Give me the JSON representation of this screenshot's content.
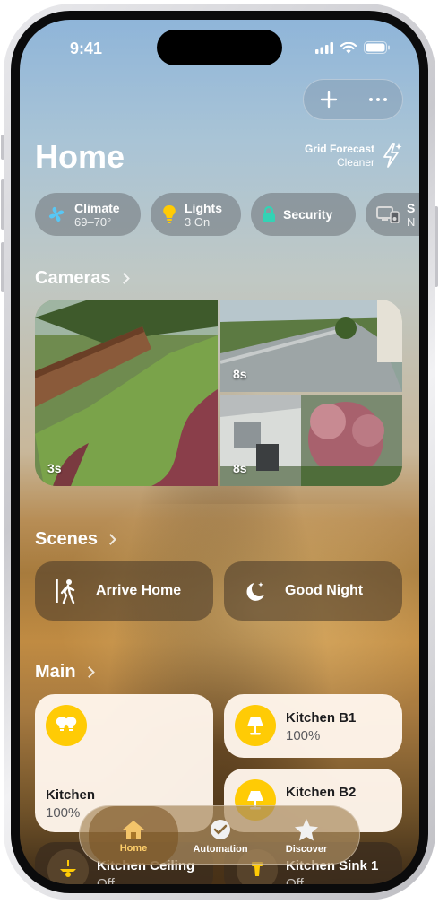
{
  "status": {
    "time": "9:41"
  },
  "header": {
    "title": "Home",
    "forecast_title": "Grid Forecast",
    "forecast_value": "Cleaner"
  },
  "toolbar": {
    "add_icon": "plus-icon",
    "more_icon": "ellipsis-icon"
  },
  "chips": [
    {
      "label": "Climate",
      "sub": "69–70°",
      "icon": "fan-icon",
      "color": "#58c7f5"
    },
    {
      "label": "Lights",
      "sub": "3 On",
      "icon": "bulb-icon",
      "color": "#ffcb05"
    },
    {
      "label": "Security",
      "sub": "",
      "icon": "lock-icon",
      "color": "#33d3b5"
    },
    {
      "label": "S",
      "sub": "N",
      "icon": "speaker-icon",
      "color": "#d8d8d8"
    }
  ],
  "sections": {
    "cameras": "Cameras",
    "scenes": "Scenes",
    "main": "Main"
  },
  "cameras": [
    {
      "label": "3s"
    },
    {
      "label": "8s"
    },
    {
      "label": "8s"
    }
  ],
  "scenes": [
    {
      "label": "Arrive Home",
      "icon": "walking-person-icon"
    },
    {
      "label": "Good Night",
      "icon": "moon-stars-icon"
    }
  ],
  "accessories": [
    {
      "name": "Kitchen",
      "value": "100%",
      "icon": "double-bulb-icon"
    },
    {
      "name": "Kitchen B1",
      "value": "100%",
      "icon": "lamp-icon"
    },
    {
      "name": "Kitchen B2",
      "value": "",
      "icon": "lamp-icon"
    },
    {
      "name": "Kitchen Ceiling",
      "value": "Off",
      "icon": "ceiling-fan-icon"
    },
    {
      "name": "Kitchen Sink 1",
      "value": "Off",
      "icon": "spotlight-icon"
    }
  ],
  "tabs": [
    {
      "label": "Home",
      "icon": "house-icon",
      "active": true
    },
    {
      "label": "Automation",
      "icon": "clock-check-icon",
      "active": false
    },
    {
      "label": "Discover",
      "icon": "star-icon",
      "active": false
    }
  ],
  "colors": {
    "accent": "#ffcb05",
    "tile_bg": "#fff6ec"
  }
}
